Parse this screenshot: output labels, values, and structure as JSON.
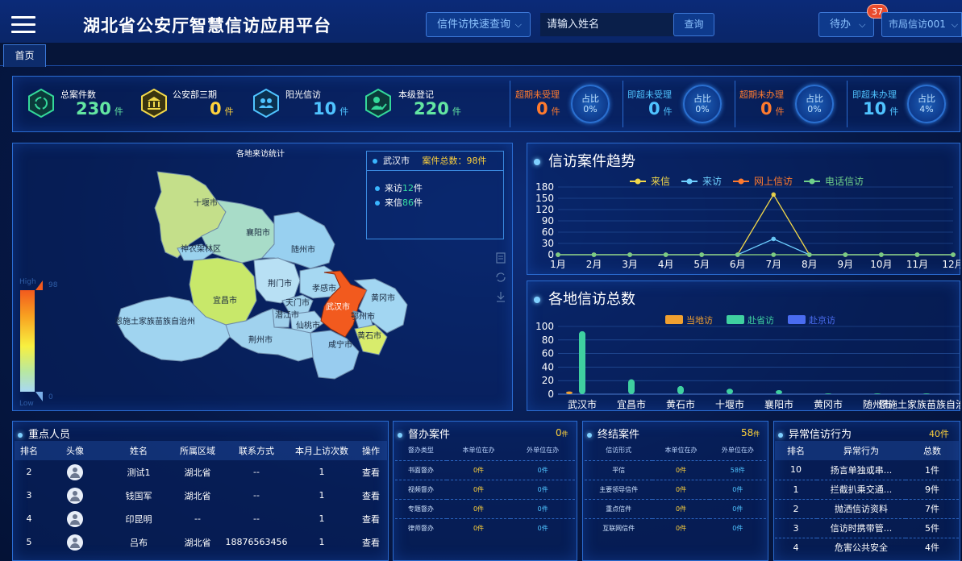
{
  "header": {
    "title": "湖北省公安厅智慧信访应用平台",
    "quick_query": "信件访快速查询",
    "search_placeholder": "请输入姓名",
    "search_btn": "查询",
    "todo_btn": "待办",
    "todo_badge": "37",
    "user_btn": "市局信访001"
  },
  "tabs": [
    "首页"
  ],
  "stats": [
    {
      "label": "总案件数",
      "value": "230",
      "unit": "件",
      "color": "#63e6a2",
      "icon": "recycle-icon"
    },
    {
      "label": "公安部三期",
      "value": "0",
      "unit": "件",
      "color": "#ffd23c",
      "icon": "bank-icon"
    },
    {
      "label": "阳光信访",
      "value": "10",
      "unit": "件",
      "color": "#4fc3ff",
      "icon": "people-icon"
    },
    {
      "label": "本级登记",
      "value": "220",
      "unit": "件",
      "color": "#63e6a2",
      "icon": "person-check-icon"
    }
  ],
  "ratios": [
    {
      "label": "超期未受理",
      "value": "0",
      "unit": "件",
      "ratio_label": "占比",
      "ratio": "0%",
      "color": "#ff7a2e"
    },
    {
      "label": "即超未受理",
      "value": "0",
      "unit": "件",
      "ratio_label": "占比",
      "ratio": "0%",
      "color": "#4fc3ff"
    },
    {
      "label": "超期未办理",
      "value": "0",
      "unit": "件",
      "ratio_label": "占比",
      "ratio": "0%",
      "color": "#ff7a2e"
    },
    {
      "label": "即超未办理",
      "value": "10",
      "unit": "件",
      "ratio_label": "占比",
      "ratio": "4%",
      "color": "#4fc3ff"
    }
  ],
  "map": {
    "title": "各地来访统计",
    "legend_city": "武汉市",
    "legend_total_label": "案件总数：",
    "legend_total": "98件",
    "visit_label": "来访",
    "visit_num": "12",
    "letter_label": "来信",
    "letter_num": "86",
    "unit": "件",
    "scale_high": "High",
    "scale_low": "Low",
    "scale_max": "98",
    "scale_min": "0",
    "cities": [
      "十堰市",
      "神农架林区",
      "襄阳市",
      "随州市",
      "宜昌市",
      "荆门市",
      "孝感市",
      "天门市",
      "潜江市",
      "仙桃市",
      "武汉市",
      "黄冈市",
      "鄂州市",
      "黄石市",
      "咸宁市",
      "荆州市",
      "恩施土家族苗族自治州"
    ]
  },
  "trend": {
    "title": "信访案件趋势",
    "chart_data": {
      "type": "line",
      "categories": [
        "1月",
        "2月",
        "3月",
        "4月",
        "5月",
        "6月",
        "7月",
        "8月",
        "9月",
        "10月",
        "11月",
        "12月"
      ],
      "series": [
        {
          "name": "来信",
          "color": "#f2d84a",
          "values": [
            0,
            0,
            0,
            0,
            0,
            0,
            160,
            0,
            0,
            0,
            0,
            0
          ]
        },
        {
          "name": "来访",
          "color": "#6fd0ff",
          "values": [
            0,
            0,
            0,
            0,
            0,
            0,
            42,
            0,
            0,
            0,
            0,
            0
          ]
        },
        {
          "name": "网上信访",
          "color": "#ff7a2e",
          "values": [
            0,
            0,
            0,
            0,
            0,
            0,
            0,
            0,
            0,
            0,
            0,
            0
          ]
        },
        {
          "name": "电话信访",
          "color": "#6fd08a",
          "values": [
            0,
            0,
            0,
            0,
            0,
            0,
            0,
            0,
            0,
            0,
            0,
            0
          ]
        }
      ],
      "yticks": [
        "0",
        "15",
        "30",
        "45",
        "60",
        "75",
        "90",
        "105",
        "120",
        "135",
        "150",
        "165",
        "180"
      ],
      "ylim": [
        0,
        180
      ]
    }
  },
  "regional": {
    "title": "各地信访总数",
    "chart_data": {
      "type": "bar",
      "categories": [
        "武汉市",
        "宜昌市",
        "黄石市",
        "十堰市",
        "襄阳市",
        "黄冈市",
        "随州市",
        "恩施土家族苗族自治州"
      ],
      "series": [
        {
          "name": "当地访",
          "color": "#f0a030",
          "values": [
            4,
            0,
            0,
            0,
            0,
            0,
            0,
            0
          ]
        },
        {
          "name": "赴省访",
          "color": "#3fd0a0",
          "values": [
            93,
            22,
            12,
            8,
            6,
            1,
            1,
            1
          ]
        },
        {
          "name": "赴京访",
          "color": "#4a6cf0",
          "values": [
            0,
            0,
            0,
            0,
            0,
            0,
            0,
            0
          ]
        }
      ],
      "yticks": [
        "0",
        "20",
        "40",
        "60",
        "80",
        "100"
      ],
      "ylim": [
        0,
        100
      ]
    }
  },
  "key_persons": {
    "title": "重点人员",
    "headers": [
      "排名",
      "头像",
      "姓名",
      "所属区域",
      "联系方式",
      "本月上访次数",
      "操作"
    ],
    "rows": [
      {
        "rank": "2",
        "name": "测试1",
        "area": "湖北省",
        "phone": "--",
        "count": "1",
        "action": "查看"
      },
      {
        "rank": "3",
        "name": "钱国军",
        "area": "湖北省",
        "phone": "--",
        "count": "1",
        "action": "查看"
      },
      {
        "rank": "4",
        "name": "印昆明",
        "area": "--",
        "phone": "--",
        "count": "1",
        "action": "查看"
      },
      {
        "rank": "5",
        "name": "吕布",
        "area": "湖北省",
        "phone": "18876563456",
        "count": "1",
        "action": "查看"
      }
    ]
  },
  "pending_cases": {
    "title": "督办案件",
    "count": "0",
    "unit": "件",
    "headers": [
      "督办类型",
      "本单位在办",
      "外单位在办"
    ],
    "rows": [
      [
        "书面督办",
        "0件",
        "0件"
      ],
      [
        "视频督办",
        "0件",
        "0件"
      ],
      [
        "专题督办",
        "0件",
        "0件"
      ],
      [
        "律师督办",
        "0件",
        "0件"
      ]
    ]
  },
  "closed_cases": {
    "title": "终结案件",
    "count": "58",
    "unit": "件",
    "headers": [
      "信访形式",
      "本单位在办",
      "外单位在办"
    ],
    "rows": [
      [
        "平信",
        "0件",
        "58件"
      ],
      [
        "主要领导信件",
        "0件",
        "0件"
      ],
      [
        "重点信件",
        "0件",
        "0件"
      ],
      [
        "互联网信件",
        "0件",
        "0件"
      ]
    ]
  },
  "abnormal": {
    "title": "异常信访行为",
    "count": "40件",
    "headers": [
      "排名",
      "异常行为",
      "总数"
    ],
    "rows": [
      {
        "rank": "10",
        "behavior": "扬言单独或串...",
        "total": "1件"
      },
      {
        "rank": "1",
        "behavior": "拦截扒乘交通...",
        "total": "9件"
      },
      {
        "rank": "2",
        "behavior": "抛洒信访资料",
        "total": "7件"
      },
      {
        "rank": "3",
        "behavior": "信访时携带管...",
        "total": "5件"
      },
      {
        "rank": "4",
        "behavior": "危害公共安全",
        "total": "4件"
      }
    ]
  }
}
